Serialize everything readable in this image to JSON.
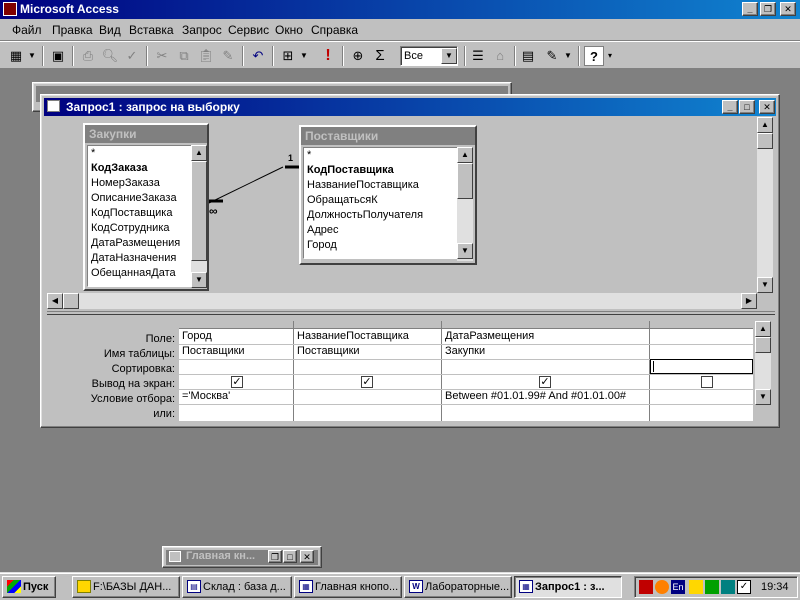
{
  "app": {
    "title": "Microsoft Access"
  },
  "menu": [
    "Файл",
    "Правка",
    "Вид",
    "Вставка",
    "Запрос",
    "Сервис",
    "Окно",
    "Справка"
  ],
  "toolbar": {
    "query_type_value": "Все",
    "sum_symbol": "Σ",
    "run_symbol": "!",
    "help_symbol": "?"
  },
  "query_window": {
    "title": "Запрос1 : запрос на выборку",
    "tables": [
      {
        "name": "Закупки",
        "fields": [
          "*",
          "КодЗаказа",
          "НомерЗаказа",
          "ОписаниеЗаказа",
          "КодПоставщика",
          "КодСотрудника",
          "ДатаРазмещения",
          "ДатаНазначения",
          "ОбещаннаяДата"
        ],
        "bold_fields": [
          "КодЗаказа"
        ]
      },
      {
        "name": "Поставщики",
        "fields": [
          "*",
          "КодПоставщика",
          "НазваниеПоставщика",
          "ОбращатьсяК",
          "ДолжностьПолучателя",
          "Адрес",
          "Город"
        ],
        "bold_fields": [
          "КодПоставщика"
        ]
      }
    ],
    "relationship": {
      "one_label": "1",
      "many_label": "∞"
    },
    "grid": {
      "row_labels": [
        "Поле:",
        "Имя таблицы:",
        "Сортировка:",
        "Вывод на экран:",
        "Условие отбора:",
        "или:"
      ],
      "columns": [
        {
          "field": "Город",
          "table": "Поставщики",
          "sort": "",
          "show": true,
          "criteria": "='Москва'"
        },
        {
          "field": "НазваниеПоставщика",
          "table": "Поставщики",
          "sort": "",
          "show": true,
          "criteria": ""
        },
        {
          "field": "ДатаРазмещения",
          "table": "Закупки",
          "sort": "",
          "show": true,
          "criteria": "Between #01.01.99# And #01.01.00#"
        },
        {
          "field": "",
          "table": "",
          "sort": "",
          "show": false,
          "criteria": ""
        }
      ]
    }
  },
  "minimized_window": {
    "title": "Главная кн..."
  },
  "taskbar": {
    "start_label": "Пуск",
    "tasks": [
      {
        "label": "F:\\БАЗЫ ДАН...",
        "active": false
      },
      {
        "label": "Склад : база д...",
        "active": false
      },
      {
        "label": "Главная кнопо...",
        "active": false
      },
      {
        "label": "Лабораторные...",
        "active": false
      },
      {
        "label": "Запрос1 : з...",
        "active": true
      }
    ],
    "language": "En",
    "clock": "19:34"
  }
}
